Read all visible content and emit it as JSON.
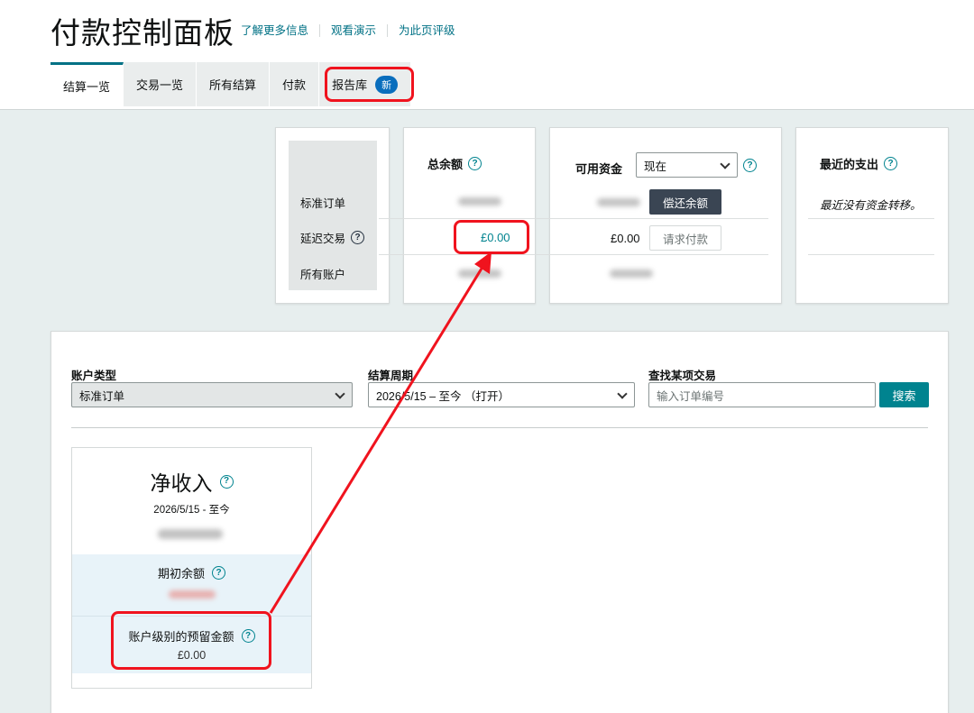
{
  "header": {
    "title": "付款控制面板",
    "links": [
      "了解更多信息",
      "观看演示",
      "为此页评级"
    ]
  },
  "tabs": [
    {
      "label": "结算一览",
      "active": true
    },
    {
      "label": "交易一览"
    },
    {
      "label": "所有结算"
    },
    {
      "label": "付款"
    },
    {
      "label": "报告库",
      "badge": "新"
    }
  ],
  "summary": {
    "rows": [
      "标准订单",
      "延迟交易",
      "所有账户"
    ],
    "total_balance": {
      "title": "总余额",
      "deferred_value": "£0.00"
    },
    "available_funds": {
      "title": "可用资金",
      "select_value": "现在",
      "repay_button": "偿还余额",
      "deferred_value": "£0.00",
      "request_button": "请求付款"
    },
    "recent_payout": {
      "title": "最近的支出",
      "message": "最近没有资金转移。"
    }
  },
  "filters": {
    "account_type": {
      "label": "账户类型",
      "value": "标准订单"
    },
    "settlement_period": {
      "label": "结算周期",
      "value": "2026/5/15 – 至今 （打开）"
    },
    "find_transaction": {
      "label": "查找某项交易",
      "placeholder": "输入订单编号",
      "button": "搜索"
    }
  },
  "net_income": {
    "title": "净收入",
    "period": "2026/5/15 - 至今",
    "opening_balance_label": "期初余额",
    "reserve_label": "账户级别的预留金额",
    "reserve_value": "£0.00"
  },
  "colors": {
    "accent": "#007185",
    "badge": "#0a6ebd",
    "annotation": "#f0131e",
    "highlight_value": "#00838f"
  },
  "icons": {
    "help": "question-circle-icon",
    "dropdown": "chevron-down-icon"
  }
}
